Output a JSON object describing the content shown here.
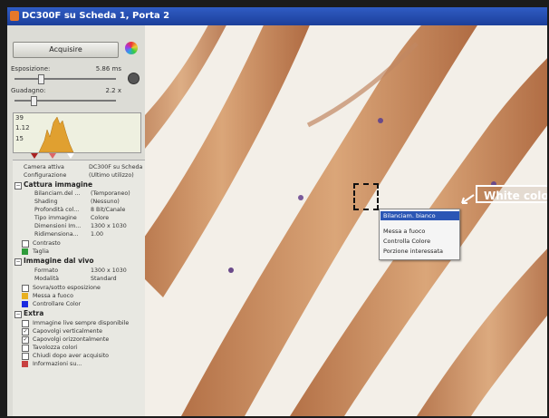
{
  "window": {
    "title": "DC300F su Scheda 1, Porta 2"
  },
  "panel": {
    "acquire_label": "Acquisire",
    "exposure_label": "Esposizione:",
    "exposure_value": "5.86 ms",
    "gain_label": "Guadagno:",
    "gain_value": "2.2 x",
    "histogram_labels": [
      "39",
      "1.12",
      "15"
    ]
  },
  "properties": [
    {
      "name": "Camera attiva",
      "value": "DC300F su Scheda"
    },
    {
      "name": "Configurazione",
      "value": "(Ultimo utilizzo)"
    }
  ],
  "capture": {
    "header": "Cattura immagine",
    "rows": [
      {
        "name": "Bilanciam.del ...",
        "value": "(Temporaneo)"
      },
      {
        "name": "Shading",
        "value": "(Nessuno)"
      },
      {
        "name": "Profondità col...",
        "value": "8 Bit/Canale"
      },
      {
        "name": "Tipo immagine",
        "value": "Colore"
      },
      {
        "name": "Dimensioni Im...",
        "value": "1300 x 1030"
      },
      {
        "name": "Ridimensiona...",
        "value": "1.00"
      }
    ],
    "contrast_label": "Contrasto",
    "crop_label": "Taglia"
  },
  "live": {
    "header": "Immagine dal vivo",
    "rows": [
      {
        "name": "Formato",
        "value": "1300 x 1030"
      },
      {
        "name": "Modalità",
        "value": "Standard"
      }
    ],
    "over_under_label": "Sovra/sotto esposizione",
    "focus_label": "Messa a fuoco",
    "color_label": "Controllare Color"
  },
  "extra": {
    "header": "Extra",
    "items": [
      {
        "label": "Immagine live sempre disponibile",
        "checked": false
      },
      {
        "label": "Capovolgi verticalmente",
        "checked": true
      },
      {
        "label": "Capovolgi orizzontalmente",
        "checked": true
      },
      {
        "label": "Tavolozza colori",
        "checked": false
      },
      {
        "label": "Chiudi dopo aver acquisito",
        "checked": false
      }
    ],
    "info_label": "Informazioni su..."
  },
  "context_menu": {
    "items": [
      "Bilanciam. bianco",
      "Messa a fuoco",
      "Controlla Colore",
      "Porzione interessata"
    ]
  },
  "annotation": {
    "text": "White color balance"
  },
  "colors": {
    "titlebar": "#1c3f9a",
    "menu_highlight": "#2b56b5",
    "crop_swatch": "#2e9b3a",
    "focus_swatch": "#e8b020",
    "color_swatch": "#1a2ae0"
  }
}
